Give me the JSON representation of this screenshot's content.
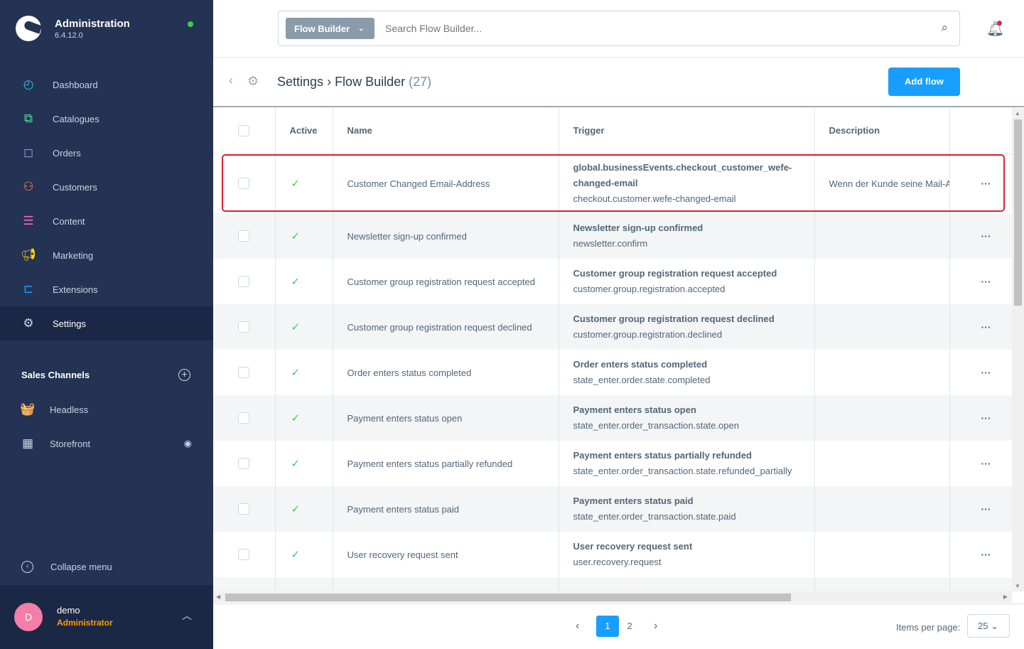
{
  "app": {
    "title": "Administration",
    "version": "6.4.12.0"
  },
  "sidebar": {
    "items": [
      {
        "label": "Dashboard",
        "icon": "dashboard-icon",
        "color": "#3cb8f0"
      },
      {
        "label": "Catalogues",
        "icon": "catalogues-icon",
        "color": "#57d9a3"
      },
      {
        "label": "Orders",
        "icon": "orders-icon",
        "color": "#a092f0"
      },
      {
        "label": "Customers",
        "icon": "customers-icon",
        "color": "#f88962"
      },
      {
        "label": "Content",
        "icon": "content-icon",
        "color": "#ff68b4"
      },
      {
        "label": "Marketing",
        "icon": "marketing-icon",
        "color": "#ffd700"
      },
      {
        "label": "Extensions",
        "icon": "extensions-icon",
        "color": "#189eff"
      },
      {
        "label": "Settings",
        "icon": "settings-icon",
        "color": "#c9d3e3",
        "active": true
      }
    ],
    "sales_channels_title": "Sales Channels",
    "sales_channels": [
      {
        "label": "Headless",
        "icon": "basket-icon"
      },
      {
        "label": "Storefront",
        "icon": "storefront-icon"
      }
    ],
    "collapse_label": "Collapse menu"
  },
  "user": {
    "initial": "D",
    "name": "demo",
    "role": "Administrator"
  },
  "search": {
    "type_label": "Flow Builder",
    "placeholder": "Search Flow Builder..."
  },
  "header": {
    "breadcrumb_parent": "Settings",
    "breadcrumb_current": "Flow Builder",
    "count": "(27)",
    "add_button": "Add flow"
  },
  "table": {
    "columns": [
      "Active",
      "Name",
      "Trigger",
      "Description"
    ],
    "rows": [
      {
        "active": true,
        "name": "Customer Changed Email-Address",
        "trigger_title": "global.businessEvents.checkout_customer_wefe-changed-email",
        "trigger_event": "checkout.customer.wefe-changed-email",
        "description": "Wenn der Kunde seine Mail-A"
      },
      {
        "active": true,
        "name": "Newsletter sign-up confirmed",
        "trigger_title": "Newsletter sign-up confirmed",
        "trigger_event": "newsletter.confirm",
        "description": ""
      },
      {
        "active": true,
        "name": "Customer group registration request accepted",
        "trigger_title": "Customer group registration request accepted",
        "trigger_event": "customer.group.registration.accepted",
        "description": ""
      },
      {
        "active": true,
        "name": "Customer group registration request declined",
        "trigger_title": "Customer group registration request declined",
        "trigger_event": "customer.group.registration.declined",
        "description": ""
      },
      {
        "active": true,
        "name": "Order enters status completed",
        "trigger_title": "Order enters status completed",
        "trigger_event": "state_enter.order.state.completed",
        "description": ""
      },
      {
        "active": true,
        "name": "Payment enters status open",
        "trigger_title": "Payment enters status open",
        "trigger_event": "state_enter.order_transaction.state.open",
        "description": ""
      },
      {
        "active": true,
        "name": "Payment enters status partially refunded",
        "trigger_title": "Payment enters status partially refunded",
        "trigger_event": "state_enter.order_transaction.state.refunded_partially",
        "description": ""
      },
      {
        "active": true,
        "name": "Payment enters status paid",
        "trigger_title": "Payment enters status paid",
        "trigger_event": "state_enter.order_transaction.state.paid",
        "description": ""
      },
      {
        "active": true,
        "name": "User recovery request sent",
        "trigger_title": "User recovery request sent",
        "trigger_event": "user.recovery.request",
        "description": ""
      }
    ]
  },
  "pagination": {
    "pages": [
      "1",
      "2"
    ],
    "current": "1",
    "items_per_page_label": "Items per page:",
    "items_per_page": "25"
  }
}
